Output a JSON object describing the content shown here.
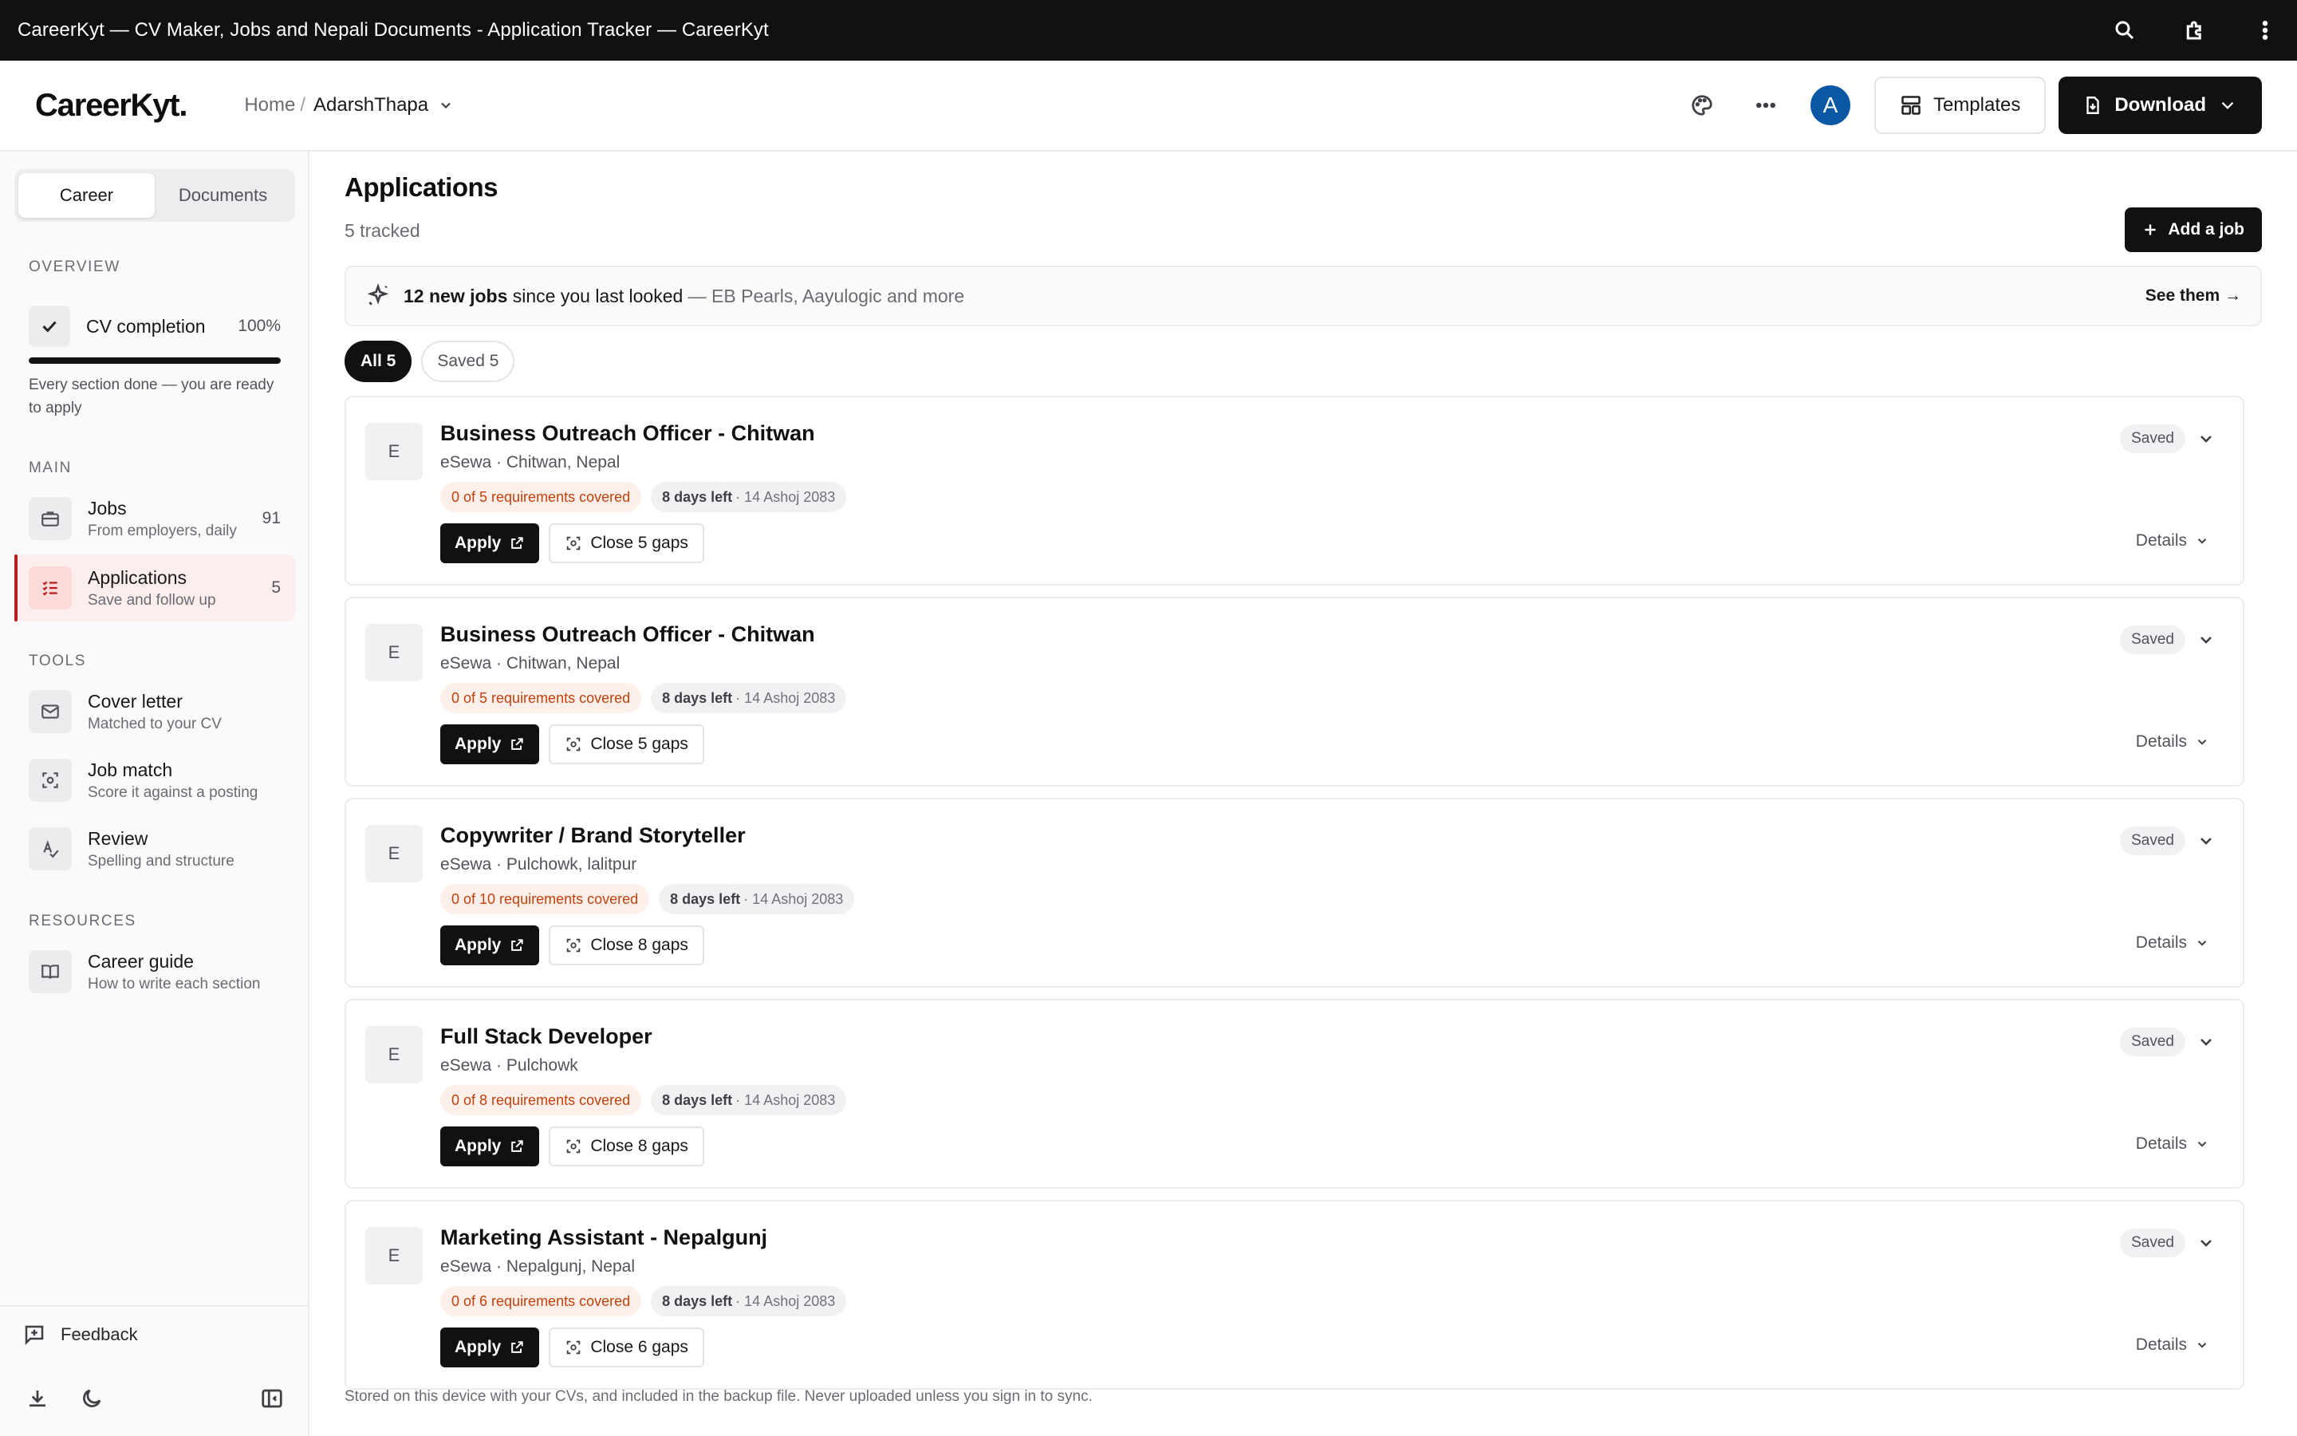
{
  "window": {
    "title": "CareerKyt — CV Maker, Jobs and Nepali Documents - Application Tracker — CareerKyt"
  },
  "header": {
    "logo": "CareerKyt.",
    "breadcrumb_home": "Home",
    "breadcrumb_sep": "/",
    "breadcrumb_current": "AdarshThapa",
    "avatar_initial": "A",
    "templates_label": "Templates",
    "download_label": "Download"
  },
  "sidebar": {
    "tabs": [
      "Career",
      "Documents"
    ],
    "active_tab": "Career",
    "overview_heading": "OVERVIEW",
    "cv_completion": {
      "label": "CV completion",
      "percent_text": "100%",
      "progress": 1.0,
      "note": "Every section done — you are ready to apply"
    },
    "main_heading": "MAIN",
    "main_items": [
      {
        "title": "Jobs",
        "subtitle": "From employers, daily",
        "count": "91",
        "icon": "briefcase-icon"
      },
      {
        "title": "Applications",
        "subtitle": "Save and follow up",
        "count": "5",
        "icon": "checklist-icon",
        "active": true
      }
    ],
    "tools_heading": "TOOLS",
    "tools_items": [
      {
        "title": "Cover letter",
        "subtitle": "Matched to your CV",
        "icon": "mail-icon"
      },
      {
        "title": "Job match",
        "subtitle": "Score it against a posting",
        "icon": "scan-icon"
      },
      {
        "title": "Review",
        "subtitle": "Spelling and structure",
        "icon": "spellcheck-icon"
      }
    ],
    "resources_heading": "RESOURCES",
    "resources_items": [
      {
        "title": "Career guide",
        "subtitle": "How to write each section",
        "icon": "book-icon"
      }
    ],
    "feedback_label": "Feedback"
  },
  "main": {
    "title": "Applications",
    "subtitle": "5 tracked",
    "add_job_label": "Add a job",
    "banner": {
      "count_text": "12 new jobs",
      "middle_text": "since you last looked",
      "rest_text": "— EB Pearls, Aayulogic and more",
      "action": "See them →"
    },
    "filters": [
      "All 5",
      "Saved 5"
    ],
    "active_filter": "All 5",
    "apply_label": "Apply",
    "details_label": "Details",
    "status_label": "Saved",
    "footer_note": "Stored on this device with your CVs, and included in the backup file. Never uploaded unless you sign in to sync."
  },
  "applications": [
    {
      "logo": "E",
      "title": "Business Outreach Officer - Chitwan",
      "meta": "eSewa · Chitwan, Nepal",
      "requirements": "0 of 5 requirements covered",
      "days_left": "8 days left",
      "deadline": "· 14 Ashoj 2083",
      "gaps": "Close 5 gaps"
    },
    {
      "logo": "E",
      "title": "Business Outreach Officer - Chitwan",
      "meta": "eSewa · Chitwan, Nepal",
      "requirements": "0 of 5 requirements covered",
      "days_left": "8 days left",
      "deadline": "· 14 Ashoj 2083",
      "gaps": "Close 5 gaps"
    },
    {
      "logo": "E",
      "title": "Copywriter / Brand Storyteller",
      "meta": "eSewa · Pulchowk, lalitpur",
      "requirements": "0 of 10 requirements covered",
      "days_left": "8 days left",
      "deadline": "· 14 Ashoj 2083",
      "gaps": "Close 8 gaps"
    },
    {
      "logo": "E",
      "title": "Full Stack Developer",
      "meta": "eSewa · Pulchowk",
      "requirements": "0 of 8 requirements covered",
      "days_left": "8 days left",
      "deadline": "· 14 Ashoj 2083",
      "gaps": "Close 8 gaps"
    },
    {
      "logo": "E",
      "title": "Marketing Assistant - Nepalgunj",
      "meta": "eSewa · Nepalgunj, Nepal",
      "requirements": "0 of 6 requirements covered",
      "days_left": "8 days left",
      "deadline": "· 14 Ashoj 2083",
      "gaps": "Close 6 gaps"
    }
  ]
}
